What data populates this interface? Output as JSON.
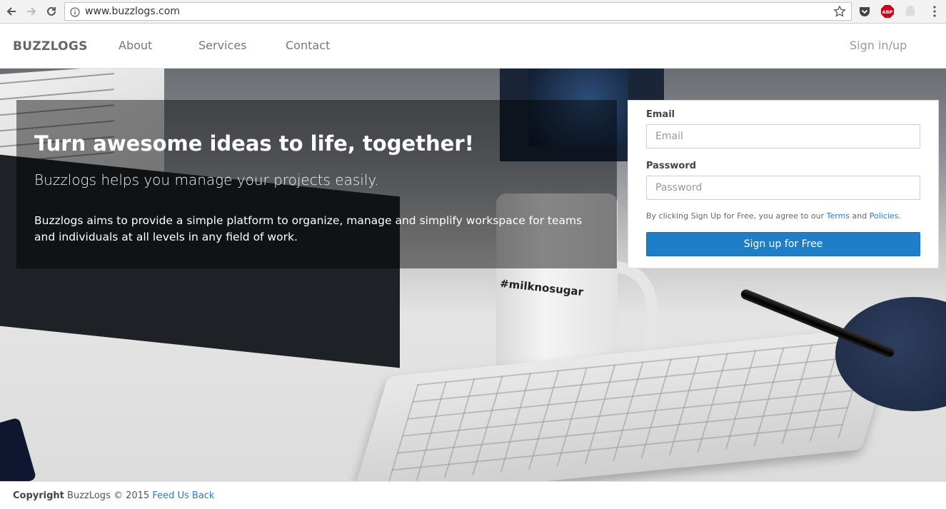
{
  "browser": {
    "url": "www.buzzlogs.com",
    "extensions": [
      "pocket-icon",
      "abp-icon",
      "ghost-icon"
    ],
    "abp_label": "ABP"
  },
  "nav": {
    "brand": "BUZZLOGS",
    "links": [
      "About",
      "Services",
      "Contact"
    ],
    "signin": "Sign in/up"
  },
  "hero": {
    "title": "Turn awesome ideas to life, together!",
    "subtitle": "Buzzlogs helps you manage your projects easily.",
    "description": "Buzzlogs aims to provide a simple platform to organize, manage and simplify workspace for teams and individuals at all levels in any field of work.",
    "mug_text": "#milknosugar"
  },
  "signup": {
    "email_label": "Email",
    "email_placeholder": "Email",
    "password_label": "Password",
    "password_placeholder": "Password",
    "terms_prefix": "By clicking Sign Up for Free, you agree to our ",
    "terms_link": "Terms",
    "terms_and": " and ",
    "policies_link": "Policies",
    "terms_suffix": ".",
    "button_label": "Sign up for Free"
  },
  "footer": {
    "copyright_label": "Copyright",
    "copyright_text": " BuzzLogs © 2015 ",
    "feedback_link": "Feed Us Back"
  },
  "colors": {
    "accent": "#1e7fc8",
    "link": "#2a7bc6"
  }
}
